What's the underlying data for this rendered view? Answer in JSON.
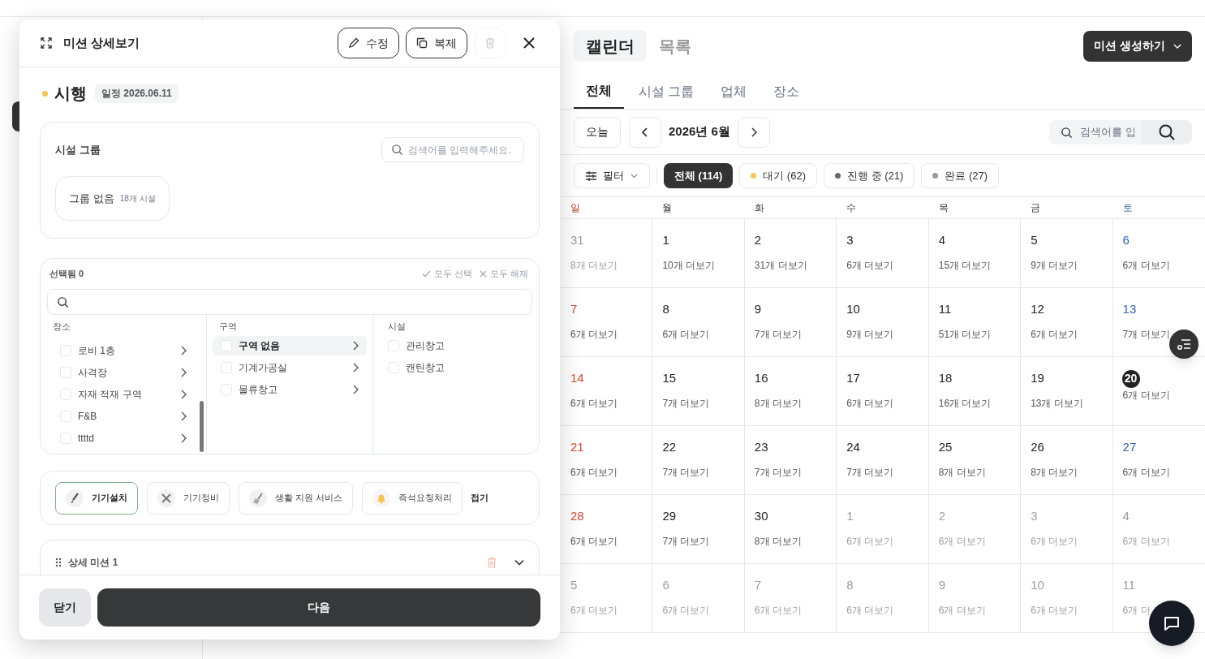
{
  "detail_panel": {
    "title": "미션 상세보기",
    "actions": [
      {
        "label": "수정",
        "kind": "edit"
      },
      {
        "label": "복제",
        "kind": "copy"
      }
    ],
    "delete_button": {
      "disabled": true
    },
    "status": {
      "label": "시행",
      "color": "#f5c451"
    },
    "schedule": "일정 2026.06.11",
    "facility_group": {
      "label": "시설 그룹",
      "search_placeholder": "검색어를 입력해주세요.",
      "groups": [
        {
          "name": "그룹 없음",
          "count": "18개 시설"
        }
      ]
    },
    "selector": {
      "selected_label": "선택됨 0",
      "select_all": "모두 선택",
      "clear_all": "모두 해제",
      "columns": [
        {
          "heading": "장소",
          "items": [
            {
              "label": "로비 1층",
              "checked": false,
              "selected": false,
              "has_children": true
            },
            {
              "label": "사격장",
              "checked": false,
              "selected": false,
              "has_children": true
            },
            {
              "label": "자재 적재 구역",
              "checked": false,
              "selected": false,
              "has_children": true
            },
            {
              "label": "F&B",
              "checked": false,
              "selected": false,
              "has_children": true
            },
            {
              "label": "ttttd",
              "checked": false,
              "selected": false,
              "has_children": true
            }
          ]
        },
        {
          "heading": "구역",
          "items": [
            {
              "label": "구역 없음",
              "checked": false,
              "selected": true,
              "has_children": true
            },
            {
              "label": "기계가공실",
              "checked": false,
              "selected": false,
              "has_children": true
            },
            {
              "label": "물류창고",
              "checked": false,
              "selected": false,
              "has_children": true
            }
          ]
        },
        {
          "heading": "시설",
          "items": [
            {
              "label": "관리창고",
              "checked": false,
              "selected": false,
              "has_children": false
            },
            {
              "label": "캔틴창고",
              "checked": false,
              "selected": false,
              "has_children": false
            }
          ]
        }
      ]
    },
    "categories": {
      "items": [
        {
          "label": "기기설치",
          "kind": "brush",
          "selected": true
        },
        {
          "label": "기기정비",
          "kind": "tools",
          "selected": false
        },
        {
          "label": "생활 지원 서비스",
          "kind": "broom",
          "selected": false
        },
        {
          "label": "즉석요청처리",
          "kind": "bell",
          "selected": false
        }
      ],
      "collapse": "접기"
    },
    "sub_missions": [
      {
        "title": "상세 미션 1"
      }
    ],
    "footer": {
      "close": "닫기",
      "next": "다음"
    }
  },
  "calendar": {
    "view_tabs": [
      {
        "label": "캘린더",
        "selected": true
      },
      {
        "label": "목록",
        "selected": false
      }
    ],
    "create_button": "미션 생성하기",
    "scope_tabs": [
      {
        "label": "전체",
        "selected": true
      },
      {
        "label": "시설 그룹",
        "selected": false
      },
      {
        "label": "업체",
        "selected": false
      },
      {
        "label": "장소",
        "selected": false
      }
    ],
    "today_button": "오늘",
    "month": "2026년 6월",
    "search_placeholder": "검색어를 입",
    "filter_button": "필터",
    "status_chips": [
      {
        "label": "전체 (114)",
        "selected": true
      },
      {
        "label": "대기 (62)",
        "color": "#f5c451",
        "selected": false
      },
      {
        "label": "진행 중 (21)",
        "color": "#5f6b63",
        "selected": false
      },
      {
        "label": "완료 (27)",
        "color": "#9a9a9a",
        "selected": false
      }
    ],
    "weekdays": [
      {
        "label": "일",
        "kind": "sunday"
      },
      {
        "label": "월",
        "kind": "weekday"
      },
      {
        "label": "화",
        "kind": "weekday"
      },
      {
        "label": "수",
        "kind": "weekday"
      },
      {
        "label": "목",
        "kind": "weekday"
      },
      {
        "label": "금",
        "kind": "weekday"
      },
      {
        "label": "토",
        "kind": "saturday"
      }
    ],
    "weeks": [
      [
        {
          "day": "31",
          "more": "8개 더보기",
          "outside": true
        },
        {
          "day": "1",
          "more": "10개 더보기",
          "outside": false
        },
        {
          "day": "2",
          "more": "31개 더보기",
          "outside": false
        },
        {
          "day": "3",
          "more": "6개 더보기",
          "outside": false
        },
        {
          "day": "4",
          "more": "15개 더보기",
          "outside": false
        },
        {
          "day": "5",
          "more": "9개 더보기",
          "outside": false
        },
        {
          "day": "6",
          "more": "6개 더보기",
          "outside": false
        }
      ],
      [
        {
          "day": "7",
          "more": "6개 더보기",
          "outside": false
        },
        {
          "day": "8",
          "more": "6개 더보기",
          "outside": false
        },
        {
          "day": "9",
          "more": "7개 더보기",
          "outside": false
        },
        {
          "day": "10",
          "more": "9개 더보기",
          "outside": false
        },
        {
          "day": "11",
          "more": "51개 더보기",
          "outside": false
        },
        {
          "day": "12",
          "more": "6개 더보기",
          "outside": false
        },
        {
          "day": "13",
          "more": "7개 더보기",
          "outside": false
        }
      ],
      [
        {
          "day": "14",
          "more": "6개 더보기",
          "outside": false
        },
        {
          "day": "15",
          "more": "7개 더보기",
          "outside": false
        },
        {
          "day": "16",
          "more": "8개 더보기",
          "outside": false
        },
        {
          "day": "17",
          "more": "6개 더보기",
          "outside": false
        },
        {
          "day": "18",
          "more": "16개 더보기",
          "outside": false
        },
        {
          "day": "19",
          "more": "13개 더보기",
          "outside": false
        },
        {
          "day": "20",
          "more": "6개 더보기",
          "outside": false,
          "today": true
        }
      ],
      [
        {
          "day": "21",
          "more": "6개 더보기",
          "outside": false
        },
        {
          "day": "22",
          "more": "7개 더보기",
          "outside": false
        },
        {
          "day": "23",
          "more": "7개 더보기",
          "outside": false
        },
        {
          "day": "24",
          "more": "7개 더보기",
          "outside": false
        },
        {
          "day": "25",
          "more": "8개 더보기",
          "outside": false
        },
        {
          "day": "26",
          "more": "8개 더보기",
          "outside": false
        },
        {
          "day": "27",
          "more": "6개 더보기",
          "outside": false
        }
      ],
      [
        {
          "day": "28",
          "more": "6개 더보기",
          "outside": false
        },
        {
          "day": "29",
          "more": "7개 더보기",
          "outside": false
        },
        {
          "day": "30",
          "more": "8개 더보기",
          "outside": false
        },
        {
          "day": "1",
          "more": "6개 더보기",
          "outside": true
        },
        {
          "day": "2",
          "more": "6개 더보기",
          "outside": true
        },
        {
          "day": "3",
          "more": "6개 더보기",
          "outside": true
        },
        {
          "day": "4",
          "more": "6개 더보기",
          "outside": true
        }
      ],
      [
        {
          "day": "5",
          "more": "6개 더보기",
          "outside": true
        },
        {
          "day": "6",
          "more": "6개 더보기",
          "outside": true
        },
        {
          "day": "7",
          "more": "6개 더보기",
          "outside": true
        },
        {
          "day": "8",
          "more": "6개 더보기",
          "outside": true
        },
        {
          "day": "9",
          "more": "6개 더보기",
          "outside": true
        },
        {
          "day": "10",
          "more": "6개 더보기",
          "outside": true
        },
        {
          "day": "11",
          "more": "6개 더",
          "outside": true
        }
      ]
    ]
  }
}
